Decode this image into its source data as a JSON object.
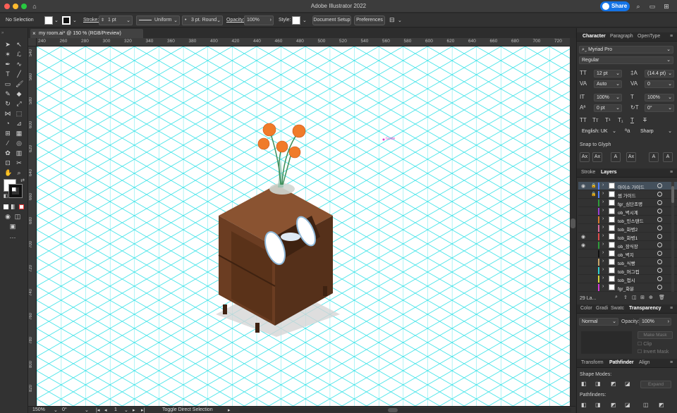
{
  "window": {
    "title": "Adobe Illustrator 2022",
    "share_label": "Share"
  },
  "control_bar": {
    "selection": "No Selection",
    "stroke_label": "Stroke:",
    "stroke_value": "1 pt",
    "profile_value": "Uniform",
    "brush_value": "3 pt. Round",
    "opacity_label": "Opacity:",
    "opacity_value": "100%",
    "style_label": "Style:",
    "document_setup": "Document Setup",
    "preferences": "Preferences"
  },
  "document": {
    "tab_title": "my room.ai* @ 150 % (RGB/Preview)",
    "smart_guide_label": "Guide"
  },
  "ruler": {
    "h_labels": [
      "240",
      "260",
      "280",
      "300",
      "320",
      "340",
      "360",
      "380",
      "400",
      "420",
      "440",
      "460",
      "480",
      "500",
      "520",
      "540",
      "560",
      "580",
      "600",
      "620",
      "640",
      "660",
      "680",
      "700",
      "720"
    ],
    "v_labels": [
      "540",
      "560",
      "580",
      "600",
      "620",
      "640",
      "660",
      "680",
      "700",
      "720",
      "740",
      "760",
      "780",
      "800",
      "820"
    ]
  },
  "status_bar": {
    "zoom": "150%",
    "rotation": "0°",
    "artboard": "1",
    "tool_hint": "Toggle Direct Selection"
  },
  "character_panel": {
    "tabs": [
      "Character",
      "Paragraph",
      "OpenType"
    ],
    "font_family": "Myriad Pro",
    "font_style": "Regular",
    "font_size": "12 pt",
    "leading": "(14.4 pt)",
    "kerning": "Auto",
    "tracking": "0",
    "vertical_scale": "100%",
    "horizontal_scale": "100%",
    "baseline_shift": "0 pt",
    "rotation": "0°",
    "language": "English: UK",
    "antialias": "Sharp",
    "snap_to_glyph": "Snap to Glyph"
  },
  "layers_panel": {
    "tabs": [
      "Stroke",
      "Layers"
    ],
    "count_label": "29 La...",
    "layers": [
      {
        "name": "아이소 가이드",
        "color": "#4f7fff",
        "visible": true,
        "locked": true,
        "selected": true
      },
      {
        "name": "썸 가이드",
        "color": "#4f7fff",
        "visible": false,
        "locked": true,
        "selected": false
      },
      {
        "name": "fgr_심단조명",
        "color": "#2f9c3b",
        "visible": false,
        "locked": false,
        "selected": false
      },
      {
        "name": "ob_벽시계",
        "color": "#9b3fd6",
        "visible": false,
        "locked": false,
        "selected": false
      },
      {
        "name": "tob_민스탠드",
        "color": "#d87b2b",
        "visible": false,
        "locked": false,
        "selected": false
      },
      {
        "name": "tob_화병2",
        "color": "#d86a9d",
        "visible": false,
        "locked": false,
        "selected": false
      },
      {
        "name": "tob_화병1",
        "color": "#e04b4b",
        "visible": true,
        "locked": false,
        "selected": false
      },
      {
        "name": "ob_장식장",
        "color": "#2f9c3b",
        "visible": true,
        "locked": false,
        "selected": false
      },
      {
        "name": "ob_벽지",
        "color": "#111111",
        "visible": false,
        "locked": false,
        "selected": false
      },
      {
        "name": "tob_식빵",
        "color": "#c8a66b",
        "visible": false,
        "locked": false,
        "selected": false
      },
      {
        "name": "tob_머그컵",
        "color": "#2fd0d0",
        "visible": false,
        "locked": false,
        "selected": false
      },
      {
        "name": "tob_접시",
        "color": "#d6d63a",
        "visible": false,
        "locked": false,
        "selected": false
      },
      {
        "name": "fgr_화분",
        "color": "#d63ad6",
        "visible": false,
        "locked": false,
        "selected": false
      }
    ]
  },
  "transparency_panel": {
    "tabs": [
      "Color",
      "Gradi",
      "Swatc",
      "Transparency"
    ],
    "blend_mode": "Normal",
    "opacity_label": "Opacity:",
    "opacity_value": "100%",
    "make_mask": "Make Mask",
    "clip": "Clip",
    "invert_mask": "Invert Mask"
  },
  "pathfinder_panel": {
    "tabs": [
      "Transform",
      "Pathfinder",
      "Align"
    ],
    "shape_modes": "Shape Modes:",
    "expand": "Expand",
    "pathfinders": "Pathfinders:"
  },
  "colors": {
    "canvas_grid": "#3be3e8",
    "cabinet_main": "#6b3d22",
    "cabinet_dark": "#4c2a15",
    "cabinet_light": "#84502c",
    "flower": "#f07b2a",
    "accent_blue": "#1473e6"
  }
}
